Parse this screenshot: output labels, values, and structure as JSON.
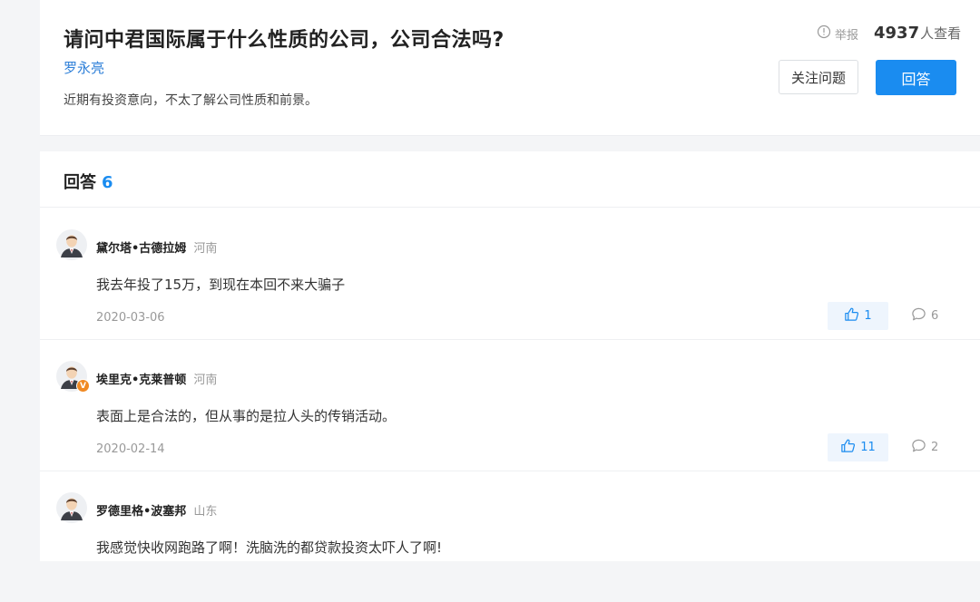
{
  "question": {
    "title": "请问中君国际属于什么性质的公司，公司合法吗?",
    "author": "罗永亮",
    "description": "近期有投资意向，不太了解公司性质和前景。",
    "report_label": "举报",
    "view_count": "4937",
    "view_suffix": "人查看",
    "follow_label": "关注问题",
    "answer_label": "回答"
  },
  "answers_section": {
    "heading": "回答",
    "count": "6"
  },
  "answers": [
    {
      "name": "黛尔塔•古德拉姆",
      "region": "河南",
      "text": "我去年投了15万，到现在本回不来大骗子",
      "date": "2020-03-06",
      "likes": "1",
      "comments": "6",
      "verified": false
    },
    {
      "name": "埃里克•克莱普顿",
      "region": "河南",
      "text": "表面上是合法的，但从事的是拉人头的传销活动。",
      "date": "2020-02-14",
      "likes": "11",
      "comments": "2",
      "verified": true,
      "badge": "V"
    },
    {
      "name": "罗德里格•波塞邦",
      "region": "山东",
      "text": "我感觉快收网跑路了啊！洗脑洗的都贷款投资太吓人了啊!",
      "verified": false
    }
  ],
  "colors": {
    "accent": "#1a8cf0",
    "author_link": "#2d7fd8",
    "like_bg": "#eef5fd",
    "verified_badge": "#f08a24"
  },
  "icons": [
    "info-icon",
    "avatar-icon",
    "verified-badge-icon",
    "thumbs-up-icon",
    "comment-icon"
  ]
}
